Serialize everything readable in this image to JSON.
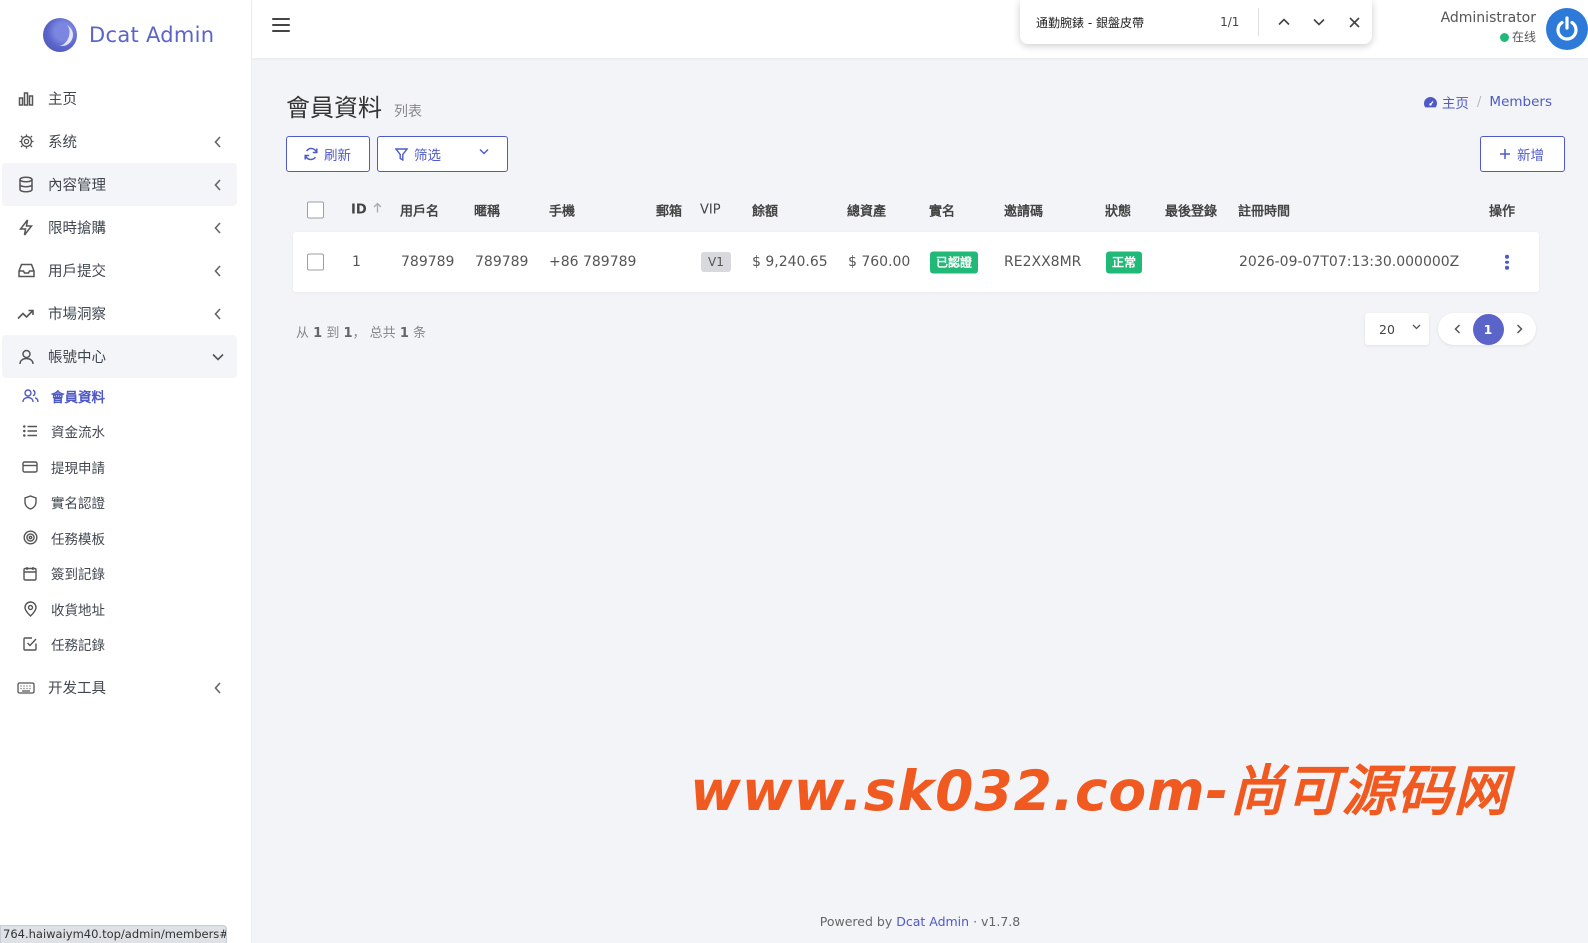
{
  "app": {
    "brand": "Dcat Admin",
    "accent_color": "#5b64c9"
  },
  "sidebar": {
    "items": [
      {
        "label": "主页",
        "icon": "bar-chart-icon"
      },
      {
        "label": "系统",
        "icon": "gear-icon"
      },
      {
        "label": "內容管理",
        "icon": "database-icon"
      },
      {
        "label": "限時搶購",
        "icon": "lightning-icon"
      },
      {
        "label": "用戶提交",
        "icon": "inbox-icon"
      },
      {
        "label": "市場洞察",
        "icon": "trending-up-icon"
      },
      {
        "label": "帳號中心",
        "icon": "user-icon"
      },
      {
        "label": "开发工具",
        "icon": "keyboard-icon"
      }
    ],
    "subitems": [
      {
        "label": "會員資料",
        "icon": "users-icon"
      },
      {
        "label": "資金流水",
        "icon": "list-icon"
      },
      {
        "label": "提現申請",
        "icon": "credit-card-icon"
      },
      {
        "label": "實名認證",
        "icon": "shield-icon"
      },
      {
        "label": "任務模板",
        "icon": "target-icon"
      },
      {
        "label": "簽到記錄",
        "icon": "calendar-icon"
      },
      {
        "label": "收貨地址",
        "icon": "map-pin-icon"
      },
      {
        "label": "任務記錄",
        "icon": "check-square-icon"
      }
    ]
  },
  "status_url": "764.haiwaiym40.top/admin/members#",
  "findbar": {
    "query": "通勤腕錶 - 銀盤皮帶",
    "count": "1/1"
  },
  "user": {
    "name": "Administrator",
    "status": "在线",
    "status_color": "#21b978"
  },
  "page": {
    "title": "會員資料",
    "subtitle": "列表"
  },
  "breadcrumb": {
    "home": "主页",
    "current": "Members"
  },
  "toolbar": {
    "refresh_label": "刷新",
    "filter_label": "筛选",
    "new_label": "新增"
  },
  "table": {
    "headers": {
      "id": "ID",
      "username": "用戶名",
      "nickname": "暱稱",
      "phone": "手機",
      "email": "郵箱",
      "vip": "VIP",
      "balance": "餘額",
      "total_assets": "總資產",
      "realname": "實名",
      "invite_code": "邀請碼",
      "status": "狀態",
      "last_login": "最後登錄",
      "register_time": "註冊時間",
      "actions": "操作"
    },
    "rows": [
      {
        "id": "1",
        "username": "789789",
        "nickname": "789789",
        "phone": "+86 789789",
        "email": "",
        "vip": "V1",
        "balance": "$ 9,240.65",
        "total_assets": "$ 760.00",
        "realname": "已認證",
        "invite_code": "RE2XX8MR",
        "status": "正常",
        "last_login": "",
        "register_time": "2026-09-07T07:13:30.000000Z"
      }
    ]
  },
  "pagination": {
    "summary_from_label": "从",
    "from": "1",
    "to_label": "到",
    "to": "1",
    "total_label": "， 总共",
    "total": "1",
    "unit": "条",
    "per_page": "20",
    "current_page": "1"
  },
  "watermark": "www.sk032.com-尚可源码网",
  "footer": {
    "powered_by": "Powered by",
    "link": "Dcat Admin",
    "separator": "·",
    "version": "v1.7.8"
  }
}
